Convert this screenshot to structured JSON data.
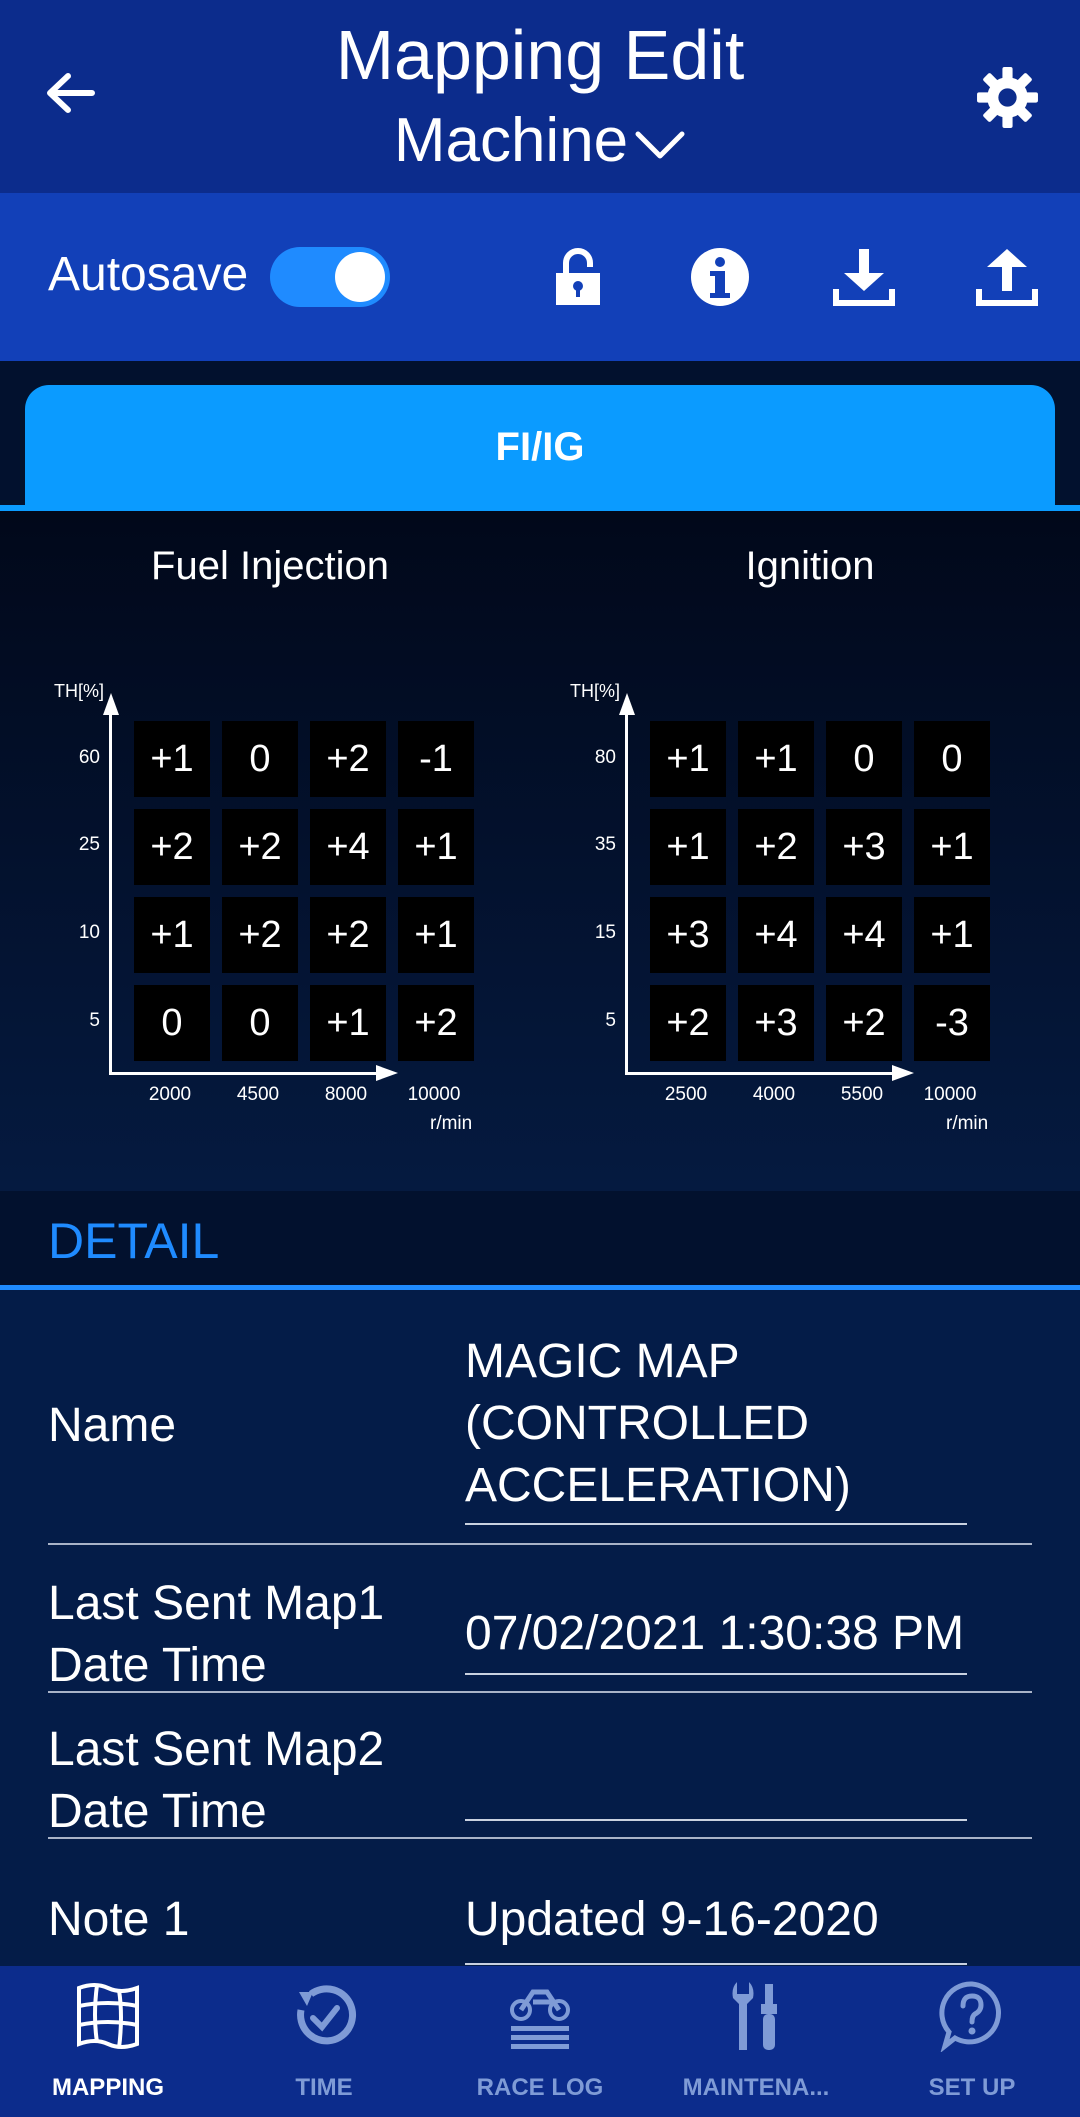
{
  "header": {
    "title": "Mapping Edit",
    "subtitle": "Machine"
  },
  "toolbar": {
    "autosave_label": "Autosave",
    "autosave_on": true
  },
  "tab": {
    "label": "FI/IG"
  },
  "fuel_map": {
    "title": "Fuel Injection",
    "y_label": "TH[%]",
    "y_ticks": [
      "60",
      "25",
      "10",
      "5"
    ],
    "x_ticks": [
      "2000",
      "4500",
      "8000",
      "10000"
    ],
    "x_unit": "r/min",
    "cells": [
      [
        "+1",
        "0",
        "+2",
        "-1"
      ],
      [
        "+2",
        "+2",
        "+4",
        "+1"
      ],
      [
        "+1",
        "+2",
        "+2",
        "+1"
      ],
      [
        "0",
        "0",
        "+1",
        "+2"
      ]
    ]
  },
  "ignition_map": {
    "title": "Ignition",
    "y_label": "TH[%]",
    "y_ticks": [
      "80",
      "35",
      "15",
      "5"
    ],
    "x_ticks": [
      "2500",
      "4000",
      "5500",
      "10000"
    ],
    "x_unit": "r/min",
    "cells": [
      [
        "+1",
        "+1",
        "0",
        "0"
      ],
      [
        "+1",
        "+2",
        "+3",
        "+1"
      ],
      [
        "+3",
        "+4",
        "+4",
        "+1"
      ],
      [
        "+2",
        "+3",
        "+2",
        "-3"
      ]
    ]
  },
  "detail": {
    "heading": "DETAIL",
    "name_label": "Name",
    "name_value_line1": "MAGIC MAP",
    "name_value_line2": "(CONTROLLED",
    "name_value_line3": "ACCELERATION)",
    "map1_label_line1": "Last Sent Map1",
    "map1_label_line2": "Date Time",
    "map1_value": "07/02/2021 1:30:38 PM",
    "map2_label_line1": "Last Sent Map2",
    "map2_label_line2": "Date Time",
    "map2_value": "",
    "note1_label": "Note 1",
    "note1_value": "Updated 9-16-2020"
  },
  "nav": {
    "items": [
      {
        "label": "MAPPING",
        "active": true
      },
      {
        "label": "TIME",
        "active": false
      },
      {
        "label": "RACE LOG",
        "active": false
      },
      {
        "label": "MAINTENA...",
        "active": false
      },
      {
        "label": "SET UP",
        "active": false
      }
    ]
  },
  "colors": {
    "header_bg": "#0c2c8c",
    "toolbar_bg": "#1240b8",
    "accent": "#0b9bff",
    "inactive_nav": "#7f9bd6"
  }
}
